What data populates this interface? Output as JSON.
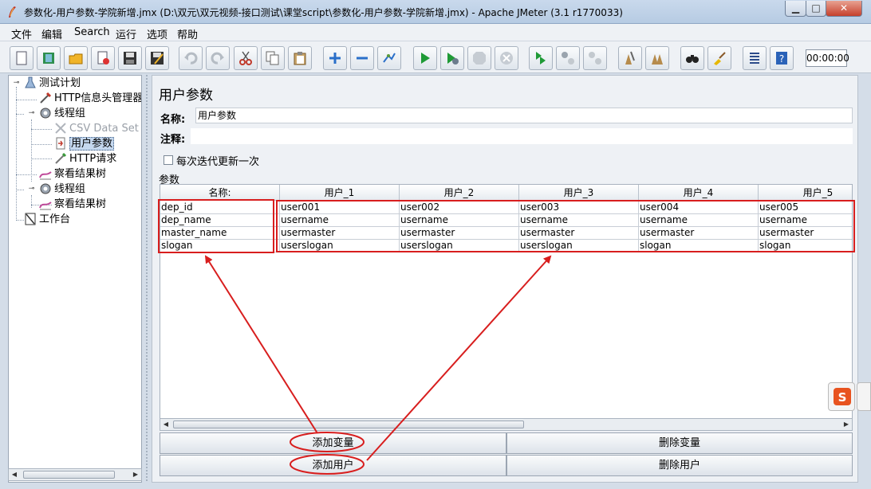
{
  "window": {
    "title": "参数化-用户参数-学院新增.jmx (D:\\双元\\双元视频-接口测试\\课堂script\\参数化-用户参数-学院新增.jmx) - Apache JMeter (3.1 r1770033)",
    "min_label": "▁",
    "max_label": "□",
    "close_label": "✕"
  },
  "menu": [
    "文件",
    "编辑",
    "Search",
    "运行",
    "选项",
    "帮助"
  ],
  "toolbar": {
    "buttons": [
      "new-icon",
      "templates-icon",
      "open-icon",
      "close-icon",
      "save-icon",
      "save-as-icon",
      "undo-icon",
      "redo-icon",
      "cut-icon",
      "copy-icon",
      "paste-icon",
      "expand-icon",
      "collapse-icon",
      "toggle-icon",
      "start-icon",
      "start-no-pause-icon",
      "stop-icon",
      "shutdown-icon",
      "remote-start-icon",
      "remote-stop-icon",
      "remote-shutdown-icon",
      "clear-icon",
      "clear-all-icon",
      "search-icon",
      "reset-search-icon",
      "function-helper-icon",
      "help-icon"
    ],
    "timer": "00:00:00"
  },
  "tree": [
    {
      "label": "测试计划",
      "icon": "test-plan-icon",
      "disabled": false,
      "selected": false
    },
    {
      "label": "HTTP信息头管理器",
      "icon": "header-manager-icon",
      "disabled": false,
      "selected": false
    },
    {
      "label": "线程组",
      "icon": "thread-group-icon",
      "disabled": false,
      "selected": false
    },
    {
      "label": "CSV Data Set Config",
      "icon": "csv-icon",
      "disabled": true,
      "selected": false
    },
    {
      "label": "用户参数",
      "icon": "user-params-icon",
      "disabled": false,
      "selected": true
    },
    {
      "label": "HTTP请求",
      "icon": "http-sampler-icon",
      "disabled": false,
      "selected": false
    },
    {
      "label": "察看结果树",
      "icon": "result-tree-icon",
      "disabled": false,
      "selected": false
    },
    {
      "label": "线程组",
      "icon": "thread-group-icon",
      "disabled": false,
      "selected": false
    },
    {
      "label": "察看结果树",
      "icon": "result-tree-icon",
      "disabled": false,
      "selected": false
    },
    {
      "label": "工作台",
      "icon": "workbench-icon",
      "disabled": false,
      "selected": false
    }
  ],
  "panel": {
    "title": "用户参数",
    "name_label": "名称:",
    "name_value": "用户参数",
    "comment_label": "注释:",
    "comment_value": "",
    "checkbox_label": "每次迭代更新一次",
    "checkbox_checked": false,
    "params_label": "参数"
  },
  "table": {
    "headers": [
      "名称:",
      "用户_1",
      "用户_2",
      "用户_3",
      "用户_4",
      "用户_5"
    ],
    "rows": [
      [
        "dep_id",
        "user001",
        "user002",
        "user003",
        "user004",
        "user005"
      ],
      [
        "dep_name",
        "username",
        "username",
        "username",
        "username",
        "username"
      ],
      [
        "master_name",
        "usermaster",
        "usermaster",
        "usermaster",
        "usermaster",
        "usermaster"
      ],
      [
        "slogan",
        "userslogan",
        "userslogan",
        "userslogan",
        "slogan",
        "slogan"
      ]
    ]
  },
  "buttons": {
    "add_var": "添加变量",
    "del_var": "删除变量",
    "add_user": "添加用户",
    "del_user": "删除用户"
  },
  "annotation_color": "#d81e1e"
}
